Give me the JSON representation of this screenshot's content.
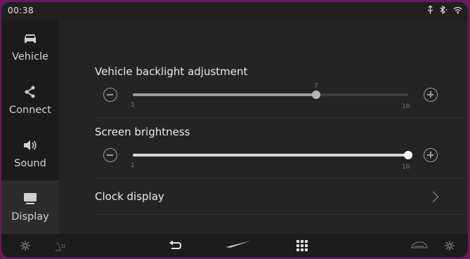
{
  "status": {
    "time": "00:38",
    "icons": [
      "usb-icon",
      "bluetooth-icon",
      "wifi-icon"
    ]
  },
  "sidebar": {
    "items": [
      {
        "label": "Vehicle",
        "icon": "car-icon",
        "active": false
      },
      {
        "label": "Connect",
        "icon": "share-icon",
        "active": false
      },
      {
        "label": "Sound",
        "icon": "speaker-icon",
        "active": false
      },
      {
        "label": "Display",
        "icon": "monitor-icon",
        "active": true
      }
    ]
  },
  "settings": {
    "backlight": {
      "label": "Vehicle backlight adjustment",
      "min": "1",
      "max": "10",
      "value": "7",
      "fraction": 0.667
    },
    "brightness": {
      "label": "Screen brightness",
      "min": "1",
      "max": "10",
      "value": "10",
      "fraction": 1.0
    },
    "clock": {
      "label": "Clock display"
    }
  },
  "bottombar": {
    "icons": [
      "fan-icon",
      "seat-heat-icon",
      "back-icon",
      "brand-logo-icon",
      "apps-grid-icon",
      "car-climate-icon",
      "fan-right-icon"
    ]
  },
  "colors": {
    "frame": "#6b1a5a",
    "slider_backlight_fill": "#9d9d9d",
    "slider_brightness_fill": "#d8d8d8",
    "thumb_backlight": "#b5b5b5",
    "thumb_brightness": "#ffffff"
  }
}
